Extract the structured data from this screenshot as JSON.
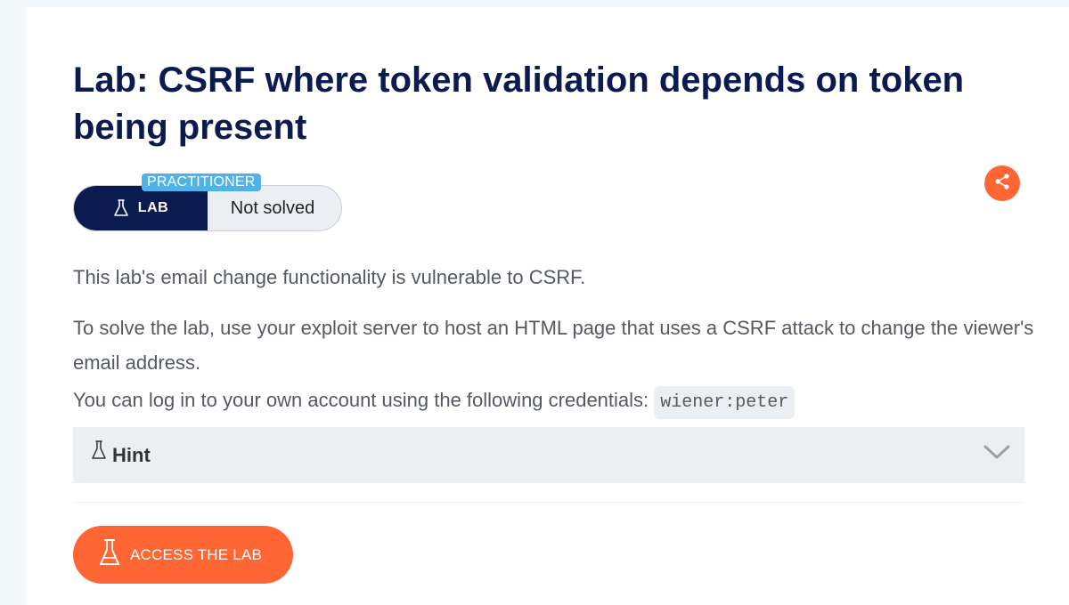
{
  "lab": {
    "title": "Lab: CSRF where token validation depends on token being present",
    "level": "PRACTITIONER",
    "badge_label": "LAB",
    "status": "Not solved"
  },
  "description": {
    "paragraph1": "This lab's email change functionality is vulnerable to CSRF.",
    "paragraph2": "To solve the lab, use your exploit server to host an HTML page that uses a CSRF attack to change the viewer's email address.",
    "paragraph3_prefix": "You can log in to your own account using the following credentials:",
    "credentials": "wiener:peter"
  },
  "hint": {
    "label": "Hint"
  },
  "actions": {
    "access_label": "ACCESS THE LAB"
  },
  "icons": {
    "lab": "flask-icon",
    "share": "share-icon",
    "chevron": "chevron-down-icon"
  },
  "colors": {
    "title": "#0c1b4f",
    "accent": "#ff6633",
    "level_badge": "#4fb3ea",
    "badge_dark": "#0c1b4f"
  }
}
